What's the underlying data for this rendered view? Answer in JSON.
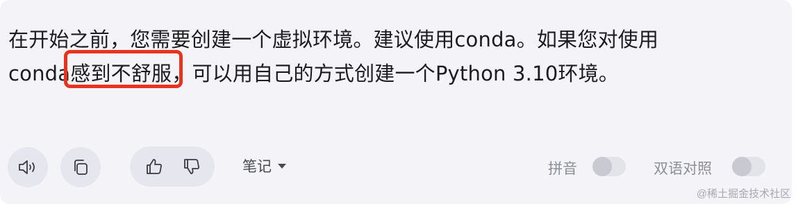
{
  "message": {
    "line1": "在开始之前，您需要创建一个虚拟环境。建议使用conda。如果您对使用",
    "line2_prefix": "conda",
    "line2_highlight": "感到不舒服",
    "line2_suffix": "，可以用自己的方式创建一个Python 3.10环境。"
  },
  "annotation": {
    "highlight_color": "#e8341c"
  },
  "actions": {
    "speaker_icon": "speaker-icon",
    "copy_icon": "copy-icon",
    "thumbs_up_icon": "thumbs-up-icon",
    "thumbs_down_icon": "thumbs-down-icon",
    "notes_label": "笔记",
    "pinyin_label": "拼音",
    "bilingual_label": "双语对照"
  },
  "watermark": "@稀土掘金技术社区"
}
